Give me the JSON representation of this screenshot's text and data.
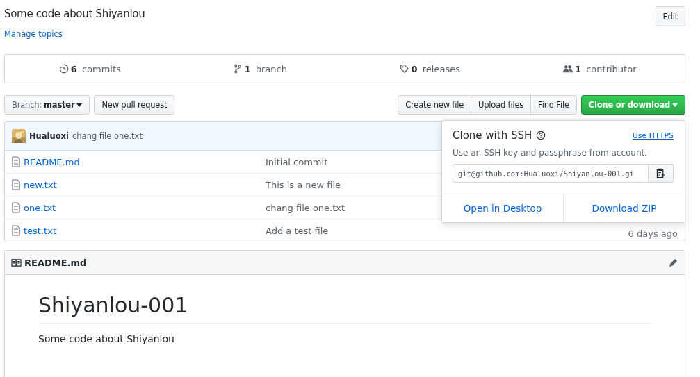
{
  "repo": {
    "description": "Some code about Shiyanlou",
    "edit_button": "Edit",
    "manage_topics": "Manage topics"
  },
  "stats": [
    {
      "kind": "commits",
      "count": "6",
      "label": "commits"
    },
    {
      "kind": "branch",
      "count": "1",
      "label": "branch"
    },
    {
      "kind": "releases",
      "count": "0",
      "label": "releases"
    },
    {
      "kind": "contributors",
      "count": "1",
      "label": "contributor"
    }
  ],
  "toolbar": {
    "branch_label": "Branch:",
    "branch": "master",
    "new_pull_request": "New pull request",
    "file_buttons": [
      "Create new file",
      "Upload files",
      "Find File"
    ],
    "clone_button": "Clone or download"
  },
  "latest_commit": {
    "author": "Hualuoxi",
    "message": "chang file one.txt"
  },
  "files": [
    {
      "name": "README.md",
      "message": "Initial commit"
    },
    {
      "name": "new.txt",
      "message": "This is a new file"
    },
    {
      "name": "one.txt",
      "message": "chang file one.txt"
    },
    {
      "name": "test.txt",
      "message": "Add a test file",
      "age": "6 days ago"
    }
  ],
  "clone_popup": {
    "title": "Clone with SSH",
    "switch_link": "Use HTTPS",
    "description": "Use an SSH key and passphrase from account.",
    "url": "git@github.com:Hualuoxi/Shiyanlou-001.gi",
    "actions": [
      "Open in Desktop",
      "Download ZIP"
    ]
  },
  "readme": {
    "file": "README.md",
    "heading": "Shiyanlou-001",
    "body": "Some code about Shiyanlou"
  }
}
